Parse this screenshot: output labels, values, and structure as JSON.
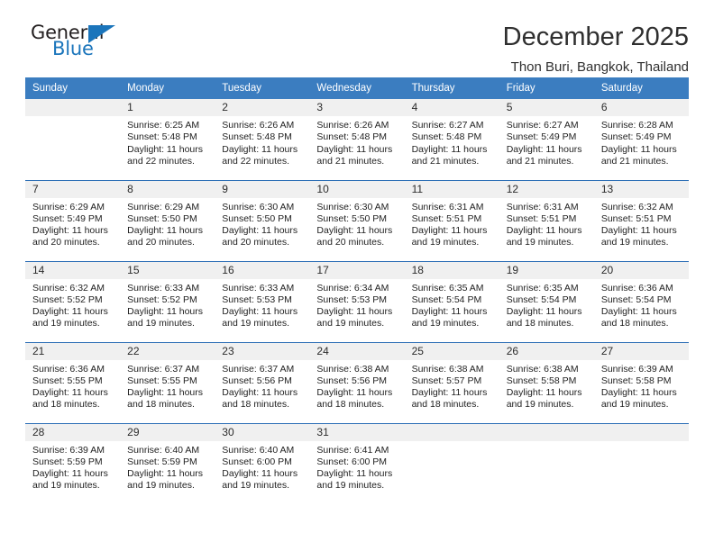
{
  "brand": {
    "name_part1": "General",
    "name_part2": "Blue",
    "accent_color": "#1b75bb",
    "triangle_icon": "brand-triangle-icon"
  },
  "header": {
    "title": "December 2025",
    "subtitle": "Thon Buri, Bangkok, Thailand"
  },
  "calendar": {
    "header_bg": "#3b7dc0",
    "row_divider_color": "#2a6db5",
    "daynum_bg": "#f0f0f0",
    "weekdays": [
      "Sunday",
      "Monday",
      "Tuesday",
      "Wednesday",
      "Thursday",
      "Friday",
      "Saturday"
    ],
    "weeks": [
      [
        {
          "day": "",
          "sunrise": "",
          "sunset": "",
          "daylight": "",
          "empty": true
        },
        {
          "day": "1",
          "sunrise": "Sunrise: 6:25 AM",
          "sunset": "Sunset: 5:48 PM",
          "daylight": "Daylight: 11 hours and 22 minutes.",
          "empty": false
        },
        {
          "day": "2",
          "sunrise": "Sunrise: 6:26 AM",
          "sunset": "Sunset: 5:48 PM",
          "daylight": "Daylight: 11 hours and 22 minutes.",
          "empty": false
        },
        {
          "day": "3",
          "sunrise": "Sunrise: 6:26 AM",
          "sunset": "Sunset: 5:48 PM",
          "daylight": "Daylight: 11 hours and 21 minutes.",
          "empty": false
        },
        {
          "day": "4",
          "sunrise": "Sunrise: 6:27 AM",
          "sunset": "Sunset: 5:48 PM",
          "daylight": "Daylight: 11 hours and 21 minutes.",
          "empty": false
        },
        {
          "day": "5",
          "sunrise": "Sunrise: 6:27 AM",
          "sunset": "Sunset: 5:49 PM",
          "daylight": "Daylight: 11 hours and 21 minutes.",
          "empty": false
        },
        {
          "day": "6",
          "sunrise": "Sunrise: 6:28 AM",
          "sunset": "Sunset: 5:49 PM",
          "daylight": "Daylight: 11 hours and 21 minutes.",
          "empty": false
        }
      ],
      [
        {
          "day": "7",
          "sunrise": "Sunrise: 6:29 AM",
          "sunset": "Sunset: 5:49 PM",
          "daylight": "Daylight: 11 hours and 20 minutes.",
          "empty": false
        },
        {
          "day": "8",
          "sunrise": "Sunrise: 6:29 AM",
          "sunset": "Sunset: 5:50 PM",
          "daylight": "Daylight: 11 hours and 20 minutes.",
          "empty": false
        },
        {
          "day": "9",
          "sunrise": "Sunrise: 6:30 AM",
          "sunset": "Sunset: 5:50 PM",
          "daylight": "Daylight: 11 hours and 20 minutes.",
          "empty": false
        },
        {
          "day": "10",
          "sunrise": "Sunrise: 6:30 AM",
          "sunset": "Sunset: 5:50 PM",
          "daylight": "Daylight: 11 hours and 20 minutes.",
          "empty": false
        },
        {
          "day": "11",
          "sunrise": "Sunrise: 6:31 AM",
          "sunset": "Sunset: 5:51 PM",
          "daylight": "Daylight: 11 hours and 19 minutes.",
          "empty": false
        },
        {
          "day": "12",
          "sunrise": "Sunrise: 6:31 AM",
          "sunset": "Sunset: 5:51 PM",
          "daylight": "Daylight: 11 hours and 19 minutes.",
          "empty": false
        },
        {
          "day": "13",
          "sunrise": "Sunrise: 6:32 AM",
          "sunset": "Sunset: 5:51 PM",
          "daylight": "Daylight: 11 hours and 19 minutes.",
          "empty": false
        }
      ],
      [
        {
          "day": "14",
          "sunrise": "Sunrise: 6:32 AM",
          "sunset": "Sunset: 5:52 PM",
          "daylight": "Daylight: 11 hours and 19 minutes.",
          "empty": false
        },
        {
          "day": "15",
          "sunrise": "Sunrise: 6:33 AM",
          "sunset": "Sunset: 5:52 PM",
          "daylight": "Daylight: 11 hours and 19 minutes.",
          "empty": false
        },
        {
          "day": "16",
          "sunrise": "Sunrise: 6:33 AM",
          "sunset": "Sunset: 5:53 PM",
          "daylight": "Daylight: 11 hours and 19 minutes.",
          "empty": false
        },
        {
          "day": "17",
          "sunrise": "Sunrise: 6:34 AM",
          "sunset": "Sunset: 5:53 PM",
          "daylight": "Daylight: 11 hours and 19 minutes.",
          "empty": false
        },
        {
          "day": "18",
          "sunrise": "Sunrise: 6:35 AM",
          "sunset": "Sunset: 5:54 PM",
          "daylight": "Daylight: 11 hours and 19 minutes.",
          "empty": false
        },
        {
          "day": "19",
          "sunrise": "Sunrise: 6:35 AM",
          "sunset": "Sunset: 5:54 PM",
          "daylight": "Daylight: 11 hours and 18 minutes.",
          "empty": false
        },
        {
          "day": "20",
          "sunrise": "Sunrise: 6:36 AM",
          "sunset": "Sunset: 5:54 PM",
          "daylight": "Daylight: 11 hours and 18 minutes.",
          "empty": false
        }
      ],
      [
        {
          "day": "21",
          "sunrise": "Sunrise: 6:36 AM",
          "sunset": "Sunset: 5:55 PM",
          "daylight": "Daylight: 11 hours and 18 minutes.",
          "empty": false
        },
        {
          "day": "22",
          "sunrise": "Sunrise: 6:37 AM",
          "sunset": "Sunset: 5:55 PM",
          "daylight": "Daylight: 11 hours and 18 minutes.",
          "empty": false
        },
        {
          "day": "23",
          "sunrise": "Sunrise: 6:37 AM",
          "sunset": "Sunset: 5:56 PM",
          "daylight": "Daylight: 11 hours and 18 minutes.",
          "empty": false
        },
        {
          "day": "24",
          "sunrise": "Sunrise: 6:38 AM",
          "sunset": "Sunset: 5:56 PM",
          "daylight": "Daylight: 11 hours and 18 minutes.",
          "empty": false
        },
        {
          "day": "25",
          "sunrise": "Sunrise: 6:38 AM",
          "sunset": "Sunset: 5:57 PM",
          "daylight": "Daylight: 11 hours and 18 minutes.",
          "empty": false
        },
        {
          "day": "26",
          "sunrise": "Sunrise: 6:38 AM",
          "sunset": "Sunset: 5:58 PM",
          "daylight": "Daylight: 11 hours and 19 minutes.",
          "empty": false
        },
        {
          "day": "27",
          "sunrise": "Sunrise: 6:39 AM",
          "sunset": "Sunset: 5:58 PM",
          "daylight": "Daylight: 11 hours and 19 minutes.",
          "empty": false
        }
      ],
      [
        {
          "day": "28",
          "sunrise": "Sunrise: 6:39 AM",
          "sunset": "Sunset: 5:59 PM",
          "daylight": "Daylight: 11 hours and 19 minutes.",
          "empty": false
        },
        {
          "day": "29",
          "sunrise": "Sunrise: 6:40 AM",
          "sunset": "Sunset: 5:59 PM",
          "daylight": "Daylight: 11 hours and 19 minutes.",
          "empty": false
        },
        {
          "day": "30",
          "sunrise": "Sunrise: 6:40 AM",
          "sunset": "Sunset: 6:00 PM",
          "daylight": "Daylight: 11 hours and 19 minutes.",
          "empty": false
        },
        {
          "day": "31",
          "sunrise": "Sunrise: 6:41 AM",
          "sunset": "Sunset: 6:00 PM",
          "daylight": "Daylight: 11 hours and 19 minutes.",
          "empty": false
        },
        {
          "day": "",
          "sunrise": "",
          "sunset": "",
          "daylight": "",
          "empty": true
        },
        {
          "day": "",
          "sunrise": "",
          "sunset": "",
          "daylight": "",
          "empty": true
        },
        {
          "day": "",
          "sunrise": "",
          "sunset": "",
          "daylight": "",
          "empty": true
        }
      ]
    ]
  }
}
